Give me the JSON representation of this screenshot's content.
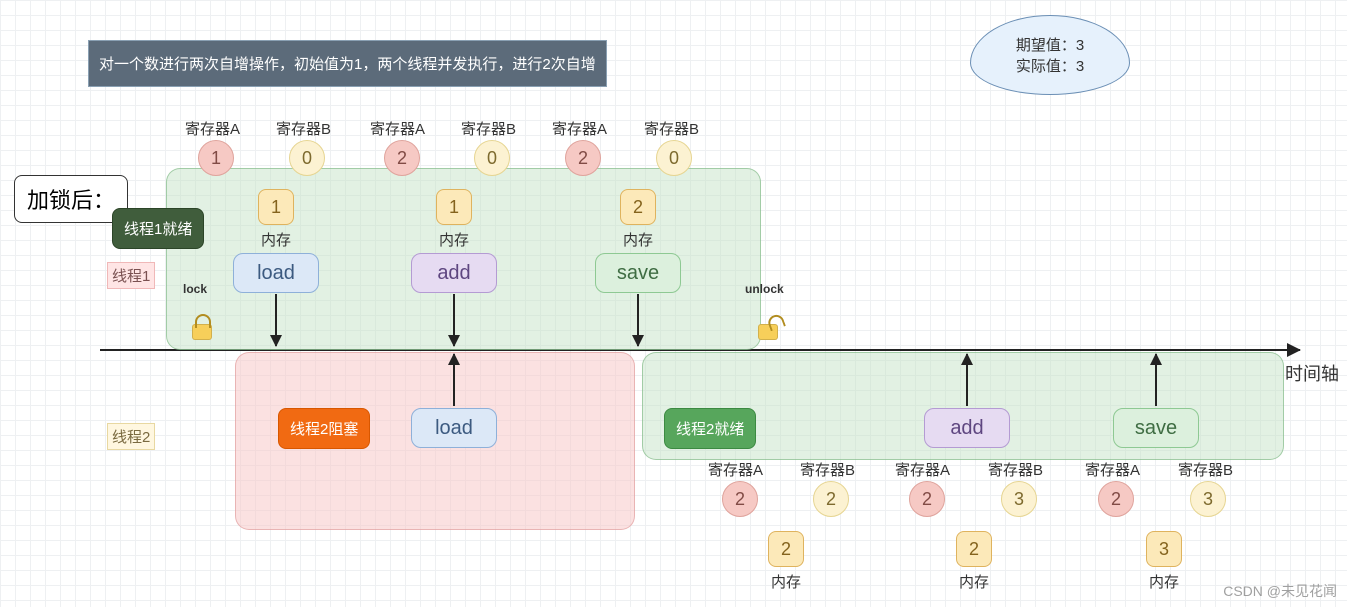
{
  "title": "对一个数进行两次自增操作，初始值为1，两个线程并发执行，进行2次自增",
  "cloud": {
    "expected_label": "期望值：",
    "expected_value": "3",
    "actual_label": "实际值：",
    "actual_value": "3"
  },
  "heading": "加锁后：",
  "lanes": {
    "thread1": "线程1",
    "thread2": "线程2"
  },
  "labels": {
    "regA": "寄存器A",
    "regB": "寄存器B",
    "mem": "内存",
    "lock": "lock",
    "unlock": "unlock",
    "axis": "时间轴"
  },
  "tags": {
    "t1_ready": "线程1就绪",
    "t2_blocked": "线程2阻塞",
    "t2_ready": "线程2就绪"
  },
  "ops": {
    "load": "load",
    "add": "add",
    "save": "save"
  },
  "thread1": {
    "step1": {
      "regA": "1",
      "regB": "0",
      "mem": "1"
    },
    "step2": {
      "regA": "2",
      "regB": "0",
      "mem": "1"
    },
    "step3": {
      "regA": "2",
      "regB": "0",
      "mem": "2"
    }
  },
  "thread2": {
    "step1": {
      "regA": "2",
      "regB": "2",
      "mem": "2"
    },
    "step2": {
      "regA": "2",
      "regB": "3",
      "mem": "2"
    },
    "step3": {
      "regA": "2",
      "regB": "3",
      "mem": "3"
    }
  },
  "watermark": "CSDN @未见花闻"
}
